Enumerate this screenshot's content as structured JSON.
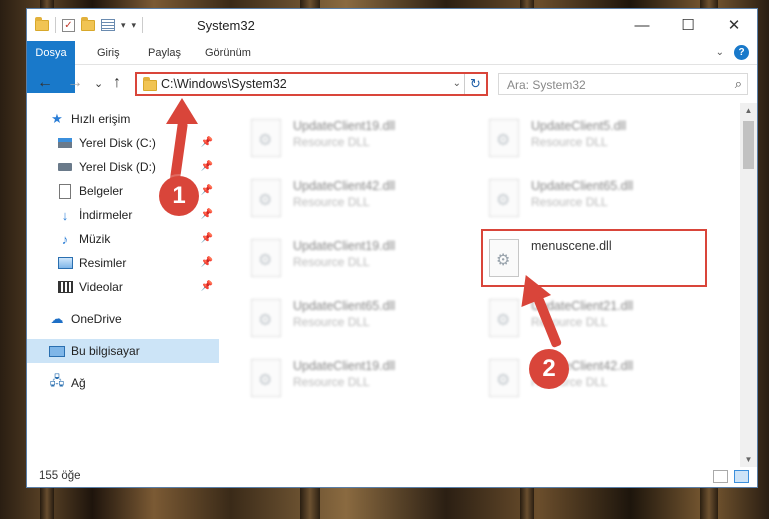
{
  "window": {
    "title": "System32",
    "controls": {
      "minimize": "—",
      "maximize": "☐",
      "close": "✕"
    }
  },
  "ribbon": {
    "tabs": [
      "Dosya",
      "Giriş",
      "Paylaş",
      "Görünüm"
    ],
    "help": "?",
    "expand": "⌄"
  },
  "nav": {
    "back": "←",
    "forward": "→",
    "recent": "⌄",
    "up": "↑"
  },
  "address": {
    "path": "C:\\Windows\\System32",
    "dropdown": "⌄",
    "refresh": "↻"
  },
  "search": {
    "placeholder": "Ara: System32",
    "icon": "⌕"
  },
  "sidebar": {
    "quick_access": "Hızlı erişim",
    "items": [
      {
        "label": "Yerel Disk (C:)",
        "icon": "drive-c-icon",
        "pinned": true
      },
      {
        "label": "Yerel Disk (D:)",
        "icon": "drive-icon",
        "pinned": true
      },
      {
        "label": "Belgeler",
        "icon": "documents-icon",
        "pinned": true
      },
      {
        "label": "İndirmeler",
        "icon": "download-icon",
        "pinned": true
      },
      {
        "label": "Müzik",
        "icon": "music-icon",
        "pinned": true
      },
      {
        "label": "Resimler",
        "icon": "pictures-icon",
        "pinned": true
      },
      {
        "label": "Videolar",
        "icon": "videos-icon",
        "pinned": true
      }
    ],
    "onedrive": "OneDrive",
    "this_pc": "Bu bilgisayar",
    "network": "Ağ"
  },
  "files": [
    {
      "name": "UpdateClient19.dll",
      "type": "Resource DLL"
    },
    {
      "name": "UpdateClient5.dll",
      "type": "Resource DLL"
    },
    {
      "name": "UpdateClient42.dll",
      "type": "Resource DLL"
    },
    {
      "name": "UpdateClient65.dll",
      "type": "Resource DLL"
    },
    {
      "name": "UpdateClient19.dll",
      "type": "Resource DLL"
    },
    {
      "name": "menuscene.dll",
      "type": ""
    },
    {
      "name": "UpdateClient65.dll",
      "type": "Resource DLL"
    },
    {
      "name": "UpdateClient21.dll",
      "type": "Resource DLL"
    },
    {
      "name": "UpdateClient19.dll",
      "type": "Resource DLL"
    },
    {
      "name": "UpdateClient42.dll",
      "type": "Resource DLL"
    }
  ],
  "status": {
    "count": "155 öğe"
  },
  "annotations": {
    "step1": "1",
    "step2": "2",
    "color": "#d9453a"
  }
}
